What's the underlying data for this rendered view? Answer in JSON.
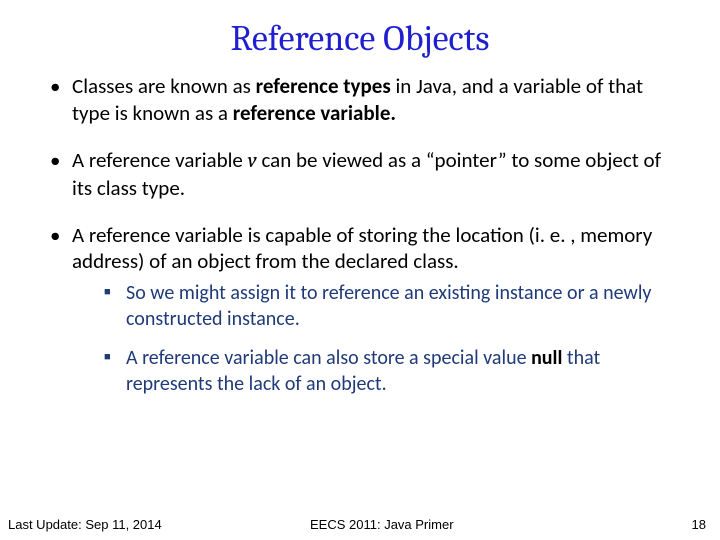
{
  "title": "Reference Objects",
  "bullets": {
    "b1a": "Classes are known as ",
    "b1b": "reference types",
    "b1c": " in Java, and a variable of that type is known as a ",
    "b1d": "reference variable.",
    "b2a": "A reference variable ",
    "b2v": "v",
    "b2b": " can be viewed as a “pointer” to some object of its class type.",
    "b3": "A reference variable is capable of storing the location (i. e. , memory address) of an object from the declared class.",
    "s1": "So we might assign it to reference an existing instance or a newly constructed instance.",
    "s2a": "A reference variable can also store a special value ",
    "s2null": "null",
    "s2b": " that represents the lack of an object."
  },
  "footer": {
    "left": "Last Update: Sep 11, 2014",
    "center": "EECS 2011: Java Primer",
    "right": "18"
  }
}
